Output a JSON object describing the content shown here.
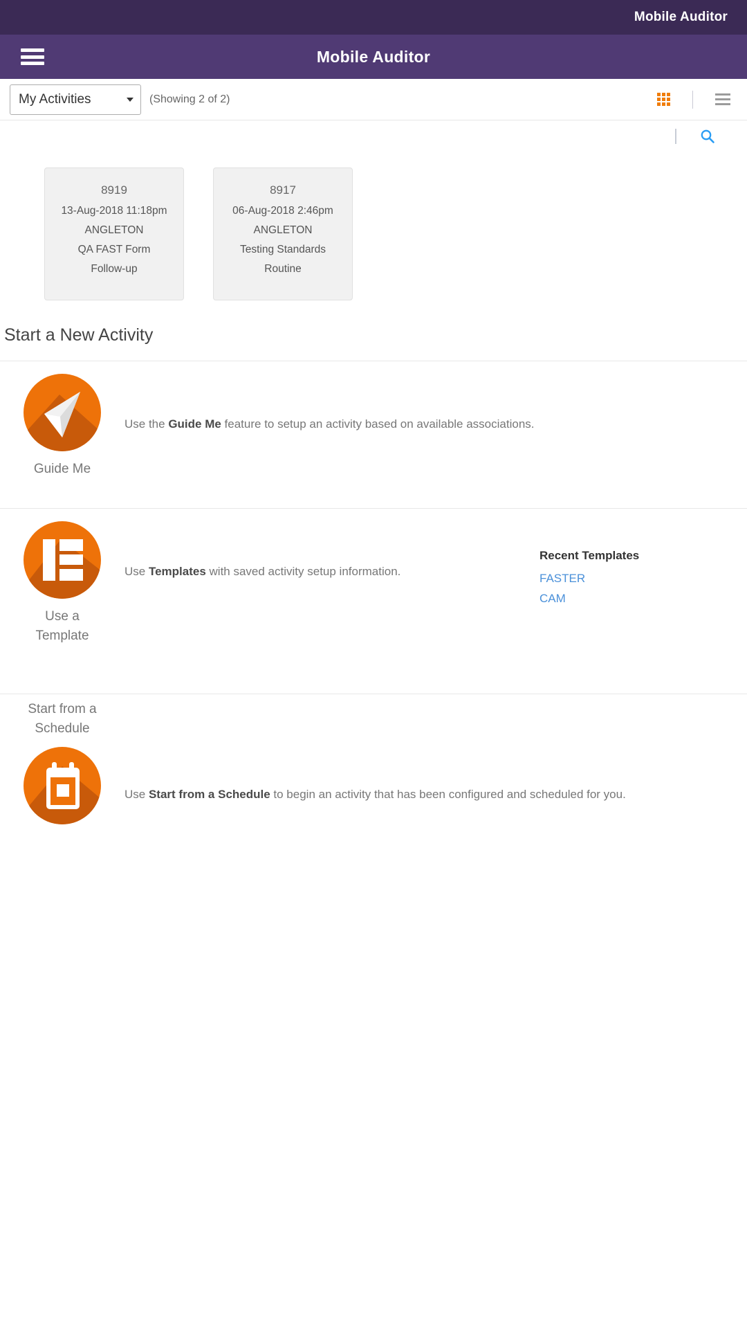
{
  "top_strip": {
    "title": "Mobile Auditor"
  },
  "header": {
    "title": "Mobile Auditor",
    "menu_icon": "hamburger-menu-icon"
  },
  "filter_bar": {
    "select_value": "My Activities",
    "select_options": [
      "My Activities"
    ],
    "showing_count": "(Showing 2 of 2)",
    "grid_view_icon": "grid-view-icon",
    "list_view_icon": "list-view-icon",
    "grid_icon_color": "#f07d0a",
    "list_icon_color": "#9b9b9b"
  },
  "search_row": {
    "search_icon": "search-icon",
    "search_icon_color": "#2a9df4"
  },
  "activities": [
    {
      "id": "8919",
      "datetime": "13-Aug-2018 11:18pm",
      "location": "ANGLETON",
      "form": "QA FAST Form",
      "type": "Follow-up"
    },
    {
      "id": "8917",
      "datetime": "06-Aug-2018 2:46pm",
      "location": "ANGLETON",
      "form": "Testing Standards",
      "type": "Routine"
    }
  ],
  "new_activity": {
    "section_title": "Start a New Activity",
    "options": [
      {
        "label": "Guide Me",
        "icon": "paper-plane-icon",
        "desc_prefix": "Use the ",
        "desc_bold": "Guide Me",
        "desc_suffix": " feature to setup an activity based on available associations."
      },
      {
        "label": "Use a\nTemplate",
        "label_line1": "Use a",
        "label_line2": "Template",
        "icon": "template-layout-icon",
        "desc_prefix": "Use ",
        "desc_bold": "Templates",
        "desc_suffix": " with saved activity setup information."
      },
      {
        "label_line1": "Start from a",
        "label_line2": "Schedule",
        "icon": "calendar-icon",
        "desc_prefix": "Use ",
        "desc_bold": "Start from a Schedule",
        "desc_suffix": " to begin an activity that has been configured and scheduled for you."
      }
    ],
    "recent_templates": {
      "title": "Recent Templates",
      "items": [
        "FASTER",
        "CAM"
      ]
    }
  },
  "colors": {
    "top_strip_purple": "#3b2a55",
    "header_purple": "#503a74",
    "accent_orange": "#ee7209",
    "link_blue": "#4a90d9"
  }
}
